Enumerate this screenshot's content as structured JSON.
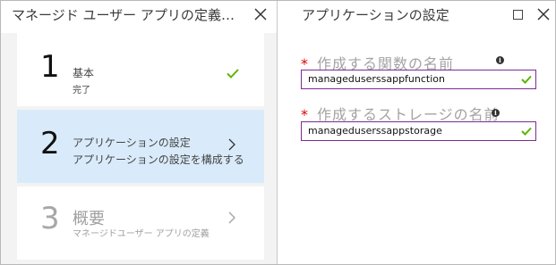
{
  "left_blade": {
    "title": "マネージド ユーザー アプリの定義…",
    "steps": [
      {
        "number": "1",
        "title": "基本",
        "subtitle": "完了",
        "state": "completed"
      },
      {
        "number": "2",
        "title": "アプリケーションの設定",
        "subtitle": "アプリケーションの設定を構成する",
        "state": "active"
      },
      {
        "number": "3",
        "title": "概要",
        "subtitle": "マネージドユーザー アプリの定義",
        "state": "disabled"
      }
    ]
  },
  "right_blade": {
    "title": "アプリケーションの設定",
    "fields": [
      {
        "required_mark": "*",
        "label": "作成する関数の名前",
        "value": "manageduserssappfunction"
      },
      {
        "required_mark": "*",
        "label": "作成するストレージの名前",
        "value": "manageduserssappstorage"
      }
    ]
  },
  "colors": {
    "accent_check": "#5db300",
    "input_border": "#7b2b95",
    "active_step": "#d9ebfa",
    "required": "#e00000"
  }
}
